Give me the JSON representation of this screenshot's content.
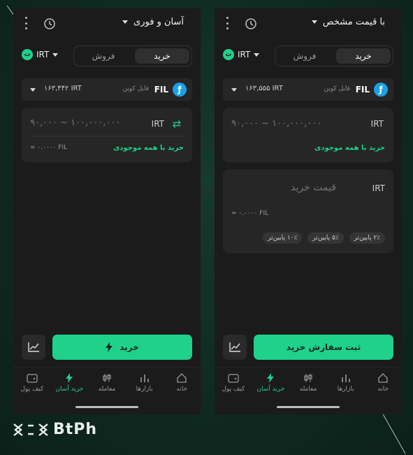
{
  "brand": {
    "name": "BtPh"
  },
  "colors": {
    "accent": "#1fd18b",
    "coin": "#1aa1e6",
    "panel": "#1b1b1b",
    "card": "#262626"
  },
  "left": {
    "mode": "آسان و فوری",
    "tabs": {
      "buy": "خرید",
      "sell": "فروش"
    },
    "currency": "IRT",
    "coin": {
      "symbol": "FIL",
      "name": "فایل کوین",
      "price": "۱۶۳,۴۴۲ IRT"
    },
    "amount": {
      "placeholder": "۹۰,۰۰۰ ~ ۱۰۰,۰۰۰,۰۰۰",
      "currency": "IRT",
      "approx": "≈ ۰.۰۰۰۰ FIL",
      "all_balance": "خرید با همه موجودی"
    },
    "buy_button": "خرید"
  },
  "right": {
    "mode": "با قیمت مشخص",
    "tabs": {
      "buy": "خرید",
      "sell": "فروش"
    },
    "currency": "IRT",
    "coin": {
      "symbol": "FIL",
      "name": "فایل کوین",
      "price": "۱۶۳,۵۵۵ IRT"
    },
    "amount": {
      "placeholder": "۹۰,۰۰۰ ~ ۱۰۰,۰۰۰,۰۰۰",
      "currency": "IRT",
      "all_balance": "خرید با همه موجودی"
    },
    "price": {
      "placeholder": "قیمت خرید",
      "currency": "IRT",
      "approx": "≈ ۰.۰۰۰۰ FIL",
      "chips": [
        "۲٪ پایین‌تر",
        "۵٪ پایین‌تر",
        "۱۰٪ پایین‌تر"
      ]
    },
    "submit_button": "ثبت سفارش خرید"
  },
  "nav": {
    "home": "خانه",
    "markets": "بازارها",
    "trade": "معامله",
    "easy_buy": "خرید آسان",
    "wallet": "کیف پول"
  }
}
